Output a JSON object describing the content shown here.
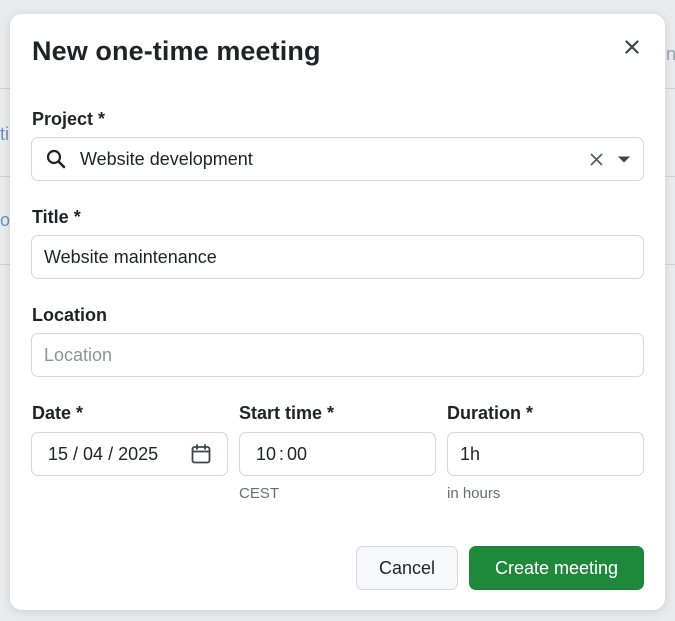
{
  "background": {
    "fragment_a": "ti",
    "fragment_b": "oc",
    "fragment_c": "n"
  },
  "dialog": {
    "title": "New one-time meeting",
    "close_icon": "close-icon"
  },
  "form": {
    "project": {
      "label": "Project",
      "required_mark": "*",
      "value": "Website development",
      "icons": [
        "search-icon",
        "clear-icon",
        "dropdown-caret-icon"
      ]
    },
    "title": {
      "label": "Title",
      "required_mark": "*",
      "value": "Website maintenance"
    },
    "location": {
      "label": "Location",
      "placeholder": "Location",
      "value": ""
    },
    "date": {
      "label": "Date",
      "required_mark": "*",
      "day": "15",
      "month": "04",
      "year": "2025",
      "sep": "/",
      "icon": "calendar-icon"
    },
    "start_time": {
      "label": "Start time",
      "required_mark": "*",
      "hour": "10",
      "minute": "00",
      "sep": ":",
      "hint": "CEST"
    },
    "duration": {
      "label": "Duration",
      "required_mark": "*",
      "value": "1h",
      "hint": "in hours"
    }
  },
  "actions": {
    "cancel_label": "Cancel",
    "submit_label": "Create meeting"
  },
  "colors": {
    "primary": "#1f883d",
    "border": "#d0d7de",
    "text": "#1f2328",
    "muted": "#656d76"
  }
}
